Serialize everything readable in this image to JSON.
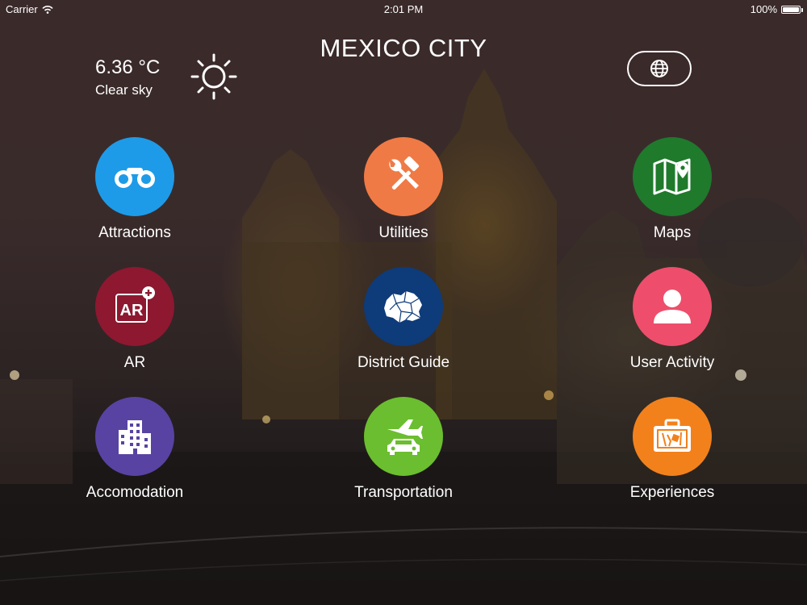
{
  "status_bar": {
    "carrier": "Carrier",
    "time": "2:01 PM",
    "battery": "100%",
    "battery_level": 1.0
  },
  "header": {
    "title": "MEXICO CITY"
  },
  "weather": {
    "temperature": "6.36 °C",
    "description": "Clear sky",
    "icon": "sun-icon"
  },
  "language_button": {
    "icon": "globe-icon"
  },
  "tiles": [
    {
      "label": "Attractions",
      "icon": "binoculars-icon",
      "color": "#1e9be8"
    },
    {
      "label": "Utilities",
      "icon": "tools-icon",
      "color": "#f07a45"
    },
    {
      "label": "Maps",
      "icon": "map-pin-icon",
      "color": "#1f7a2c"
    },
    {
      "label": "AR",
      "icon": "ar-plus-icon",
      "color": "#8d1830"
    },
    {
      "label": "District Guide",
      "icon": "district-map-icon",
      "color": "#0e3b7a"
    },
    {
      "label": "User Activity",
      "icon": "user-icon",
      "color": "#ee4e6b"
    },
    {
      "label": "Accomodation",
      "icon": "building-icon",
      "color": "#5843a2"
    },
    {
      "label": "Transportation",
      "icon": "plane-car-icon",
      "color": "#6bbe2f"
    },
    {
      "label": "Experiences",
      "icon": "suitcase-icon",
      "color": "#f2811c"
    }
  ]
}
